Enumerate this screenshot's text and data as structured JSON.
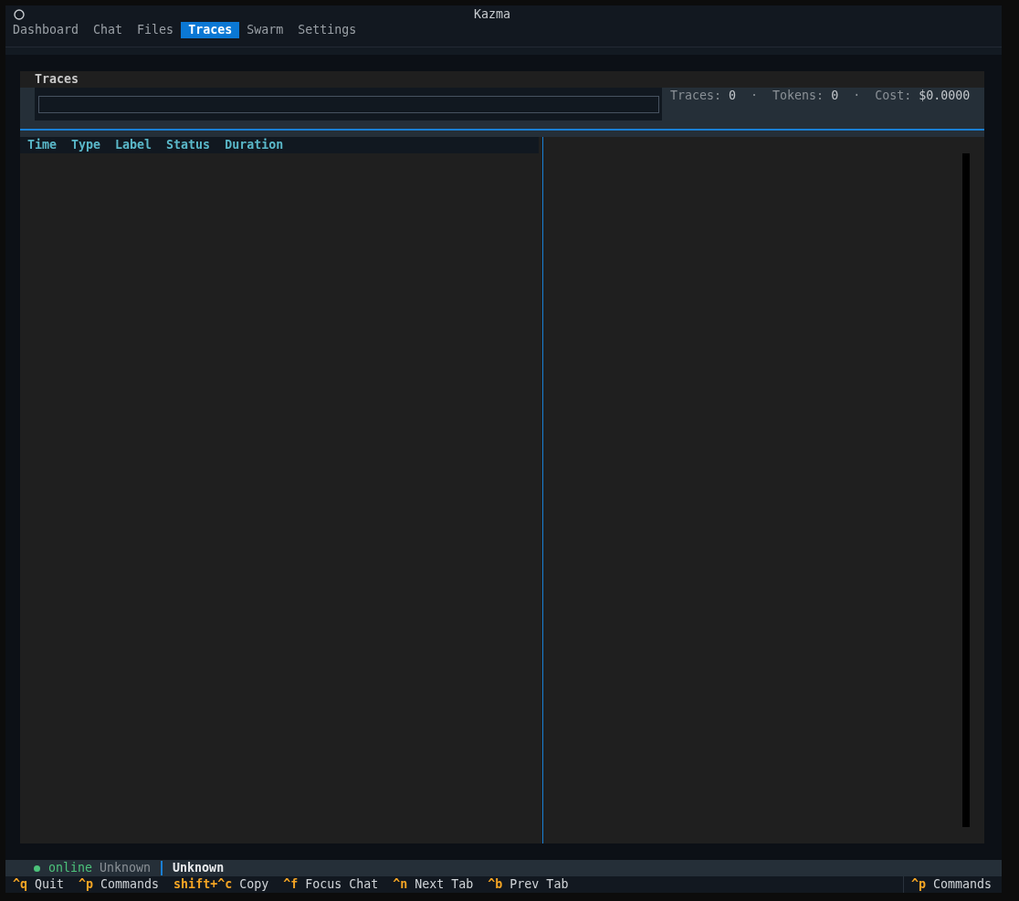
{
  "header": {
    "title": "Kazma"
  },
  "tabs": [
    {
      "label": "Dashboard",
      "selected": false
    },
    {
      "label": "Chat",
      "selected": false
    },
    {
      "label": "Files",
      "selected": false
    },
    {
      "label": "Traces",
      "selected": true
    },
    {
      "label": "Swarm",
      "selected": false
    },
    {
      "label": "Settings",
      "selected": false
    }
  ],
  "panel": {
    "title": "Traces",
    "stats": [
      {
        "label": "Traces:",
        "value": "0"
      },
      {
        "label": "Tokens:",
        "value": "0"
      },
      {
        "label": "Cost:",
        "value": "$0.0000"
      }
    ],
    "stat_separators": [
      "·",
      "·"
    ]
  },
  "table": {
    "columns": [
      "Time",
      "Type",
      "Label",
      "Status",
      "Duration"
    ]
  },
  "status_bar": {
    "connection": {
      "label": "online",
      "online": true
    },
    "model": "Unknown",
    "agent": "Unknown"
  },
  "footer": {
    "bindings": [
      {
        "key": "^q",
        "action": "Quit"
      },
      {
        "key": "^p",
        "action": "Commands"
      },
      {
        "key": "shift+^c",
        "action": "Copy"
      },
      {
        "key": "^f",
        "action": "Focus Chat"
      },
      {
        "key": "^n",
        "action": "Next Tab"
      },
      {
        "key": "^b",
        "action": "Prev Tab"
      }
    ],
    "right_bindings": [
      {
        "key": "^p",
        "action": "Commands"
      }
    ]
  }
}
